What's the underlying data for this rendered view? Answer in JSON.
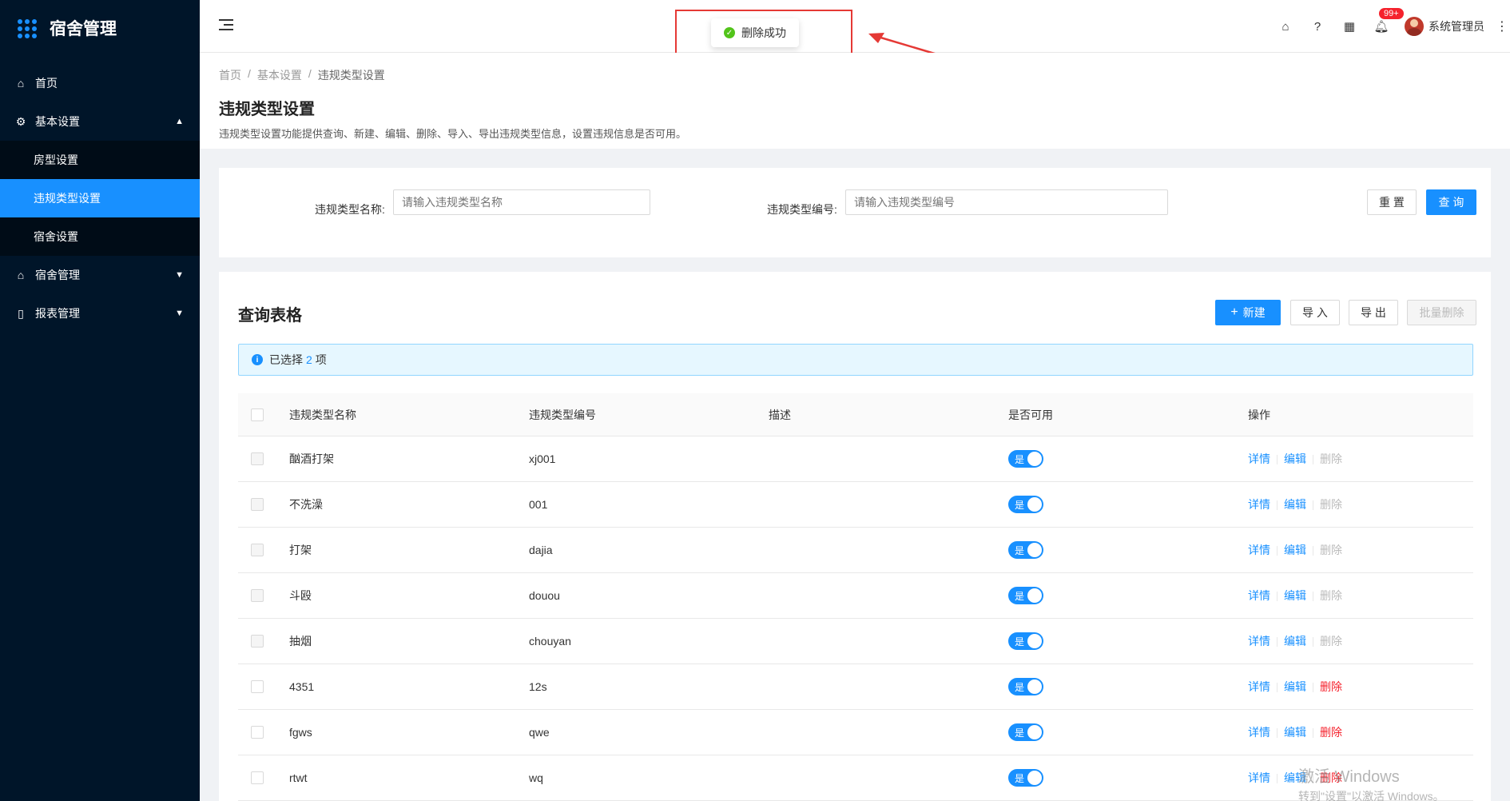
{
  "app": {
    "title": "宿舍管理"
  },
  "sidebar": {
    "items": [
      {
        "label": "首页",
        "icon": "home-icon"
      },
      {
        "label": "基本设置",
        "icon": "gear-icon",
        "expanded": true,
        "children": [
          {
            "label": "房型设置",
            "active": false
          },
          {
            "label": "违规类型设置",
            "active": true
          },
          {
            "label": "宿舍设置",
            "active": false
          }
        ]
      },
      {
        "label": "宿舍管理",
        "icon": "home-icon"
      },
      {
        "label": "报表管理",
        "icon": "book-icon"
      }
    ]
  },
  "header": {
    "badge": "99+",
    "user_name": "系统管理员"
  },
  "toast": {
    "message": "删除成功"
  },
  "breadcrumb": [
    "首页",
    "基本设置",
    "违规类型设置"
  ],
  "page": {
    "title": "违规类型设置",
    "description": "违规类型设置功能提供查询、新建、编辑、删除、导入、导出违规类型信息，设置违规信息是否可用。"
  },
  "search": {
    "name_label": "违规类型名称:",
    "name_placeholder": "请输入违规类型名称",
    "code_label": "违规类型编号:",
    "code_placeholder": "请输入违规类型编号",
    "reset_label": "重 置",
    "query_label": "查 询"
  },
  "table": {
    "title": "查询表格",
    "new_label": "新建",
    "import_label": "导 入",
    "export_label": "导 出",
    "batch_delete_label": "批量删除",
    "alert": {
      "prefix": "已选择",
      "count": "2",
      "suffix": "项"
    },
    "columns": [
      "违规类型名称",
      "违规类型编号",
      "描述",
      "是否可用",
      "操作"
    ],
    "switch_label": "是",
    "ops": {
      "detail": "详情",
      "edit": "编辑",
      "delete": "删除"
    },
    "rows": [
      {
        "name": "酗酒打架",
        "code": "xj001",
        "desc": "",
        "enabled": true,
        "deletable": false
      },
      {
        "name": "不洗澡",
        "code": "001",
        "desc": "",
        "enabled": true,
        "deletable": false
      },
      {
        "name": "打架",
        "code": "dajia",
        "desc": "",
        "enabled": true,
        "deletable": false
      },
      {
        "name": "斗殴",
        "code": "douou",
        "desc": "",
        "enabled": true,
        "deletable": false
      },
      {
        "name": "抽烟",
        "code": "chouyan",
        "desc": "",
        "enabled": true,
        "deletable": false
      },
      {
        "name": "4351",
        "code": "12s",
        "desc": "",
        "enabled": true,
        "deletable": true
      },
      {
        "name": "fgws",
        "code": "qwe",
        "desc": "",
        "enabled": true,
        "deletable": true
      },
      {
        "name": "rtwt",
        "code": "wq",
        "desc": "",
        "enabled": true,
        "deletable": true
      }
    ]
  },
  "watermark": {
    "line1": "激活 Windows",
    "line2": "转到\"设置\"以激活 Windows。"
  },
  "colors": {
    "primary": "#1890ff",
    "sidebar": "#001529",
    "danger": "#f5222d",
    "success": "#52c41a"
  }
}
